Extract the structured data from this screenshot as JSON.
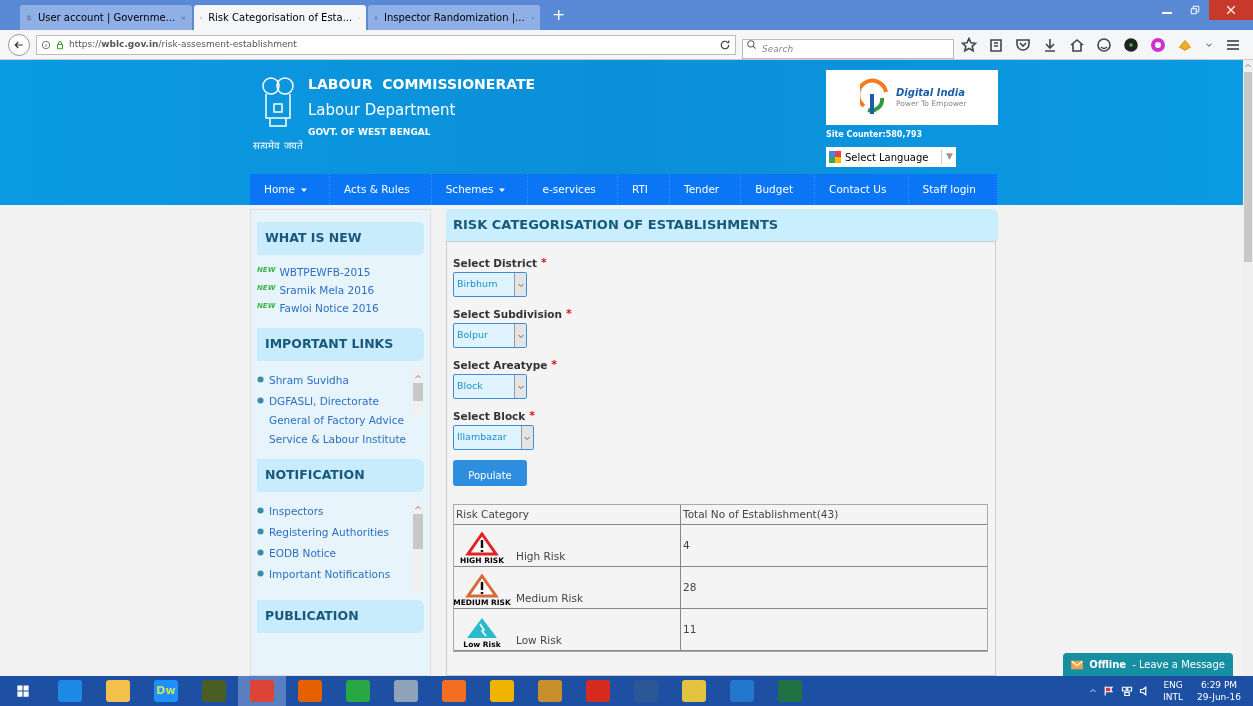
{
  "browser": {
    "tabs": [
      {
        "title": "User account | Governme...",
        "selected": false
      },
      {
        "title": "Risk Categorisation of Esta...",
        "selected": true
      },
      {
        "title": "Inspector Randomization |...",
        "selected": false
      }
    ],
    "new_tab": "+",
    "url": "https://**wblc.gov.in**/risk-assesment-establishment",
    "search": {
      "placeholder": "Search"
    }
  },
  "header": {
    "org": "LABOUR  COMMISSIONERATE",
    "dept": "Labour Department",
    "govt": "GOVT. OF WEST BENGAL",
    "motto": "सत्यमेव जयते",
    "logo": {
      "name": "Digital India",
      "tagline": "Power To Empower"
    },
    "site_counter": "Site Counter:580,793",
    "language": {
      "label": "Select Language",
      "arrow": "▼"
    }
  },
  "nav": [
    {
      "label": "Home",
      "has_menu": true
    },
    {
      "label": "Acts & Rules",
      "has_menu": false
    },
    {
      "label": "Schemes",
      "has_menu": true
    },
    {
      "label": "e-services",
      "has_menu": false
    },
    {
      "label": "RTI",
      "has_menu": false
    },
    {
      "label": "Tender",
      "has_menu": false
    },
    {
      "label": "Budget",
      "has_menu": false
    },
    {
      "label": "Contact Us",
      "has_menu": false
    },
    {
      "label": "Staff login",
      "has_menu": false
    }
  ],
  "sidebar": [
    {
      "title": "WHAT IS NEW",
      "kind": "news",
      "items": [
        {
          "badge": "NEW",
          "label": "WBTPEWFB-2015"
        },
        {
          "badge": "NEW",
          "label": "Sramik Mela 2016"
        },
        {
          "badge": "NEW",
          "label": "Fawloi Notice 2016"
        }
      ]
    },
    {
      "title": "IMPORTANT LINKS",
      "kind": "links",
      "items": [
        "Shram Suvidha",
        "DGFASLI, Directorate General of Factory Advice Service & Labour Institute"
      ]
    },
    {
      "title": "NOTIFICATION",
      "kind": "links",
      "items": [
        "Inspectors",
        "Registering Authorities",
        "EODB Notice",
        "Important Notifications"
      ]
    },
    {
      "title": "PUBLICATION",
      "kind": "heading"
    }
  ],
  "main": {
    "title": "RISK CATEGORISATION OF ESTABLISHMENTS",
    "required_mark": "*",
    "fields": [
      {
        "label": "Select District",
        "required": true,
        "value": "Birbhum"
      },
      {
        "label": "Select Subdivision",
        "required": true,
        "value": "Bolpur"
      },
      {
        "label": "Select Areatype",
        "required": true,
        "value": "Block"
      },
      {
        "label": "Select Block",
        "required": true,
        "value": "Illambazar"
      }
    ],
    "button": "Populate",
    "table": {
      "columns": [
        "Risk Category",
        "Total No of Establishment(43)"
      ],
      "rows": [
        {
          "kind": "high",
          "badge": "HIGH RISK",
          "category": "High Risk",
          "count": "4"
        },
        {
          "kind": "medium",
          "badge": "MEDIUM RISK",
          "category": "Medium Risk",
          "count": "28"
        },
        {
          "kind": "low",
          "badge": "Low Risk",
          "category": "Low Risk",
          "count": "11"
        }
      ]
    }
  },
  "chat": {
    "status": "Offline",
    "message": "- Leave a Message"
  },
  "taskbar": {
    "apps": [
      {
        "selected": false
      },
      {
        "selected": false
      },
      {
        "selected": false,
        "label": "Dw"
      },
      {
        "selected": false
      },
      {
        "selected": true
      },
      {
        "selected": false
      },
      {
        "selected": false
      },
      {
        "selected": false
      },
      {
        "selected": false
      },
      {
        "selected": false
      },
      {
        "selected": false
      },
      {
        "selected": false
      },
      {
        "selected": false
      },
      {
        "selected": false
      },
      {
        "selected": false
      },
      {
        "selected": false
      }
    ],
    "tray": {
      "lang": "ENG",
      "layout": "INTL",
      "time": "6:29 PM",
      "date": "29-Jun-16"
    }
  }
}
